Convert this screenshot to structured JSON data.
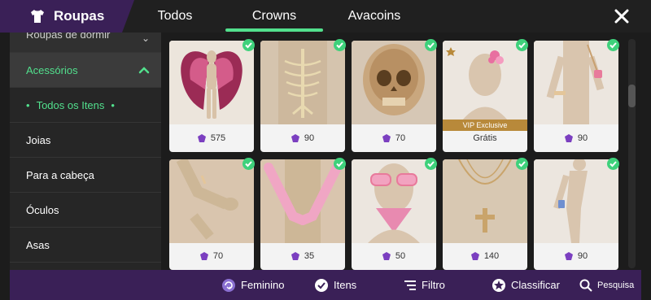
{
  "header": {
    "title": "Roupas",
    "tabs": [
      {
        "label": "Todos"
      },
      {
        "label": "Crowns"
      },
      {
        "label": "Avacoins"
      }
    ],
    "active_tab": "Crowns"
  },
  "sidebar": {
    "items": [
      {
        "label": "Roupas de dormir"
      },
      {
        "label": "Acessórios"
      },
      {
        "label": "Todos os Itens"
      },
      {
        "label": "Joias"
      },
      {
        "label": "Para a cabeça"
      },
      {
        "label": "Óculos"
      },
      {
        "label": "Asas"
      }
    ]
  },
  "grid": {
    "items": [
      {
        "price": "575",
        "icon": "winged-avatar"
      },
      {
        "price": "90",
        "icon": "skeleton-back"
      },
      {
        "price": "70",
        "icon": "skull-mask"
      },
      {
        "price": "Grátis",
        "badge": "VIP Exclusive",
        "icon": "flower-hair"
      },
      {
        "price": "90",
        "icon": "bag-accessory"
      },
      {
        "price": "70",
        "icon": "bracelet-hands"
      },
      {
        "price": "35",
        "icon": "pink-gloves"
      },
      {
        "price": "50",
        "icon": "pink-glasses-bandana"
      },
      {
        "price": "140",
        "icon": "cross-necklace"
      },
      {
        "price": "90",
        "icon": "phone-accessory"
      }
    ]
  },
  "bottombar": {
    "feminino": "Feminino",
    "itens": "Itens",
    "filtro": "Filtro",
    "classificar": "Classificar",
    "pesquisa": "Pesquisa"
  },
  "colors": {
    "accent_green": "#52e08d",
    "brand_purple": "#3a2057",
    "check_green": "#3ed17b",
    "vip_gold": "#b8893a"
  }
}
